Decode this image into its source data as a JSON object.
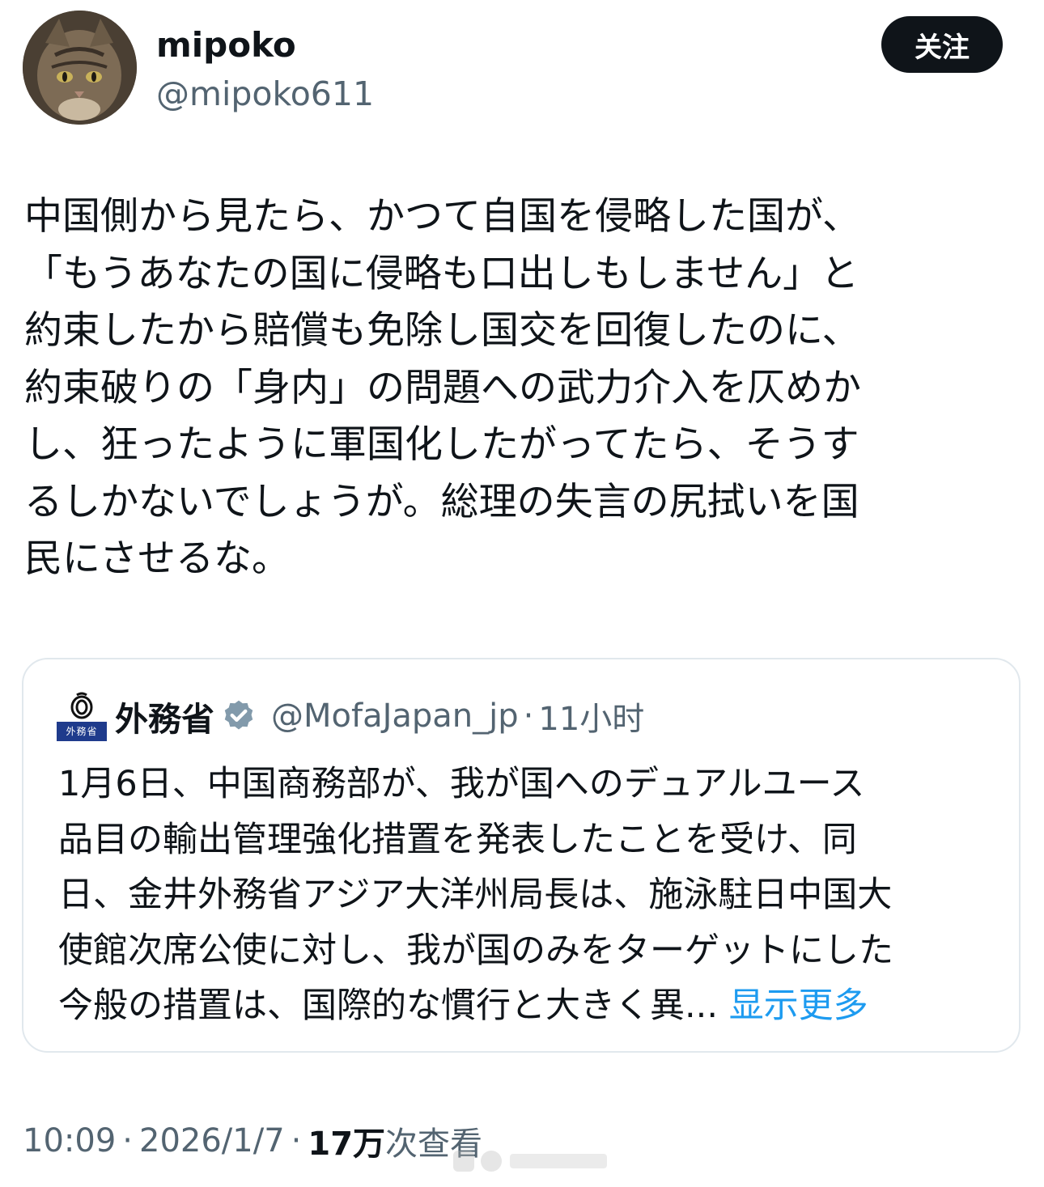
{
  "author": {
    "display_name": "mipoko",
    "handle": "@mipoko611",
    "avatar_icon": "cat-avatar"
  },
  "follow_button": {
    "label": "关注"
  },
  "tweet": {
    "lines": [
      "中国側から見たら、かつて自国を侵略した国が、",
      "「もうあなたの国に侵略も口出しもしません」と",
      "約束したから賠償も免除し国交を回復したのに、",
      "約束破りの「身内」の問題への武力介入を仄めか",
      "し、狂ったように軍国化したがってたら、そうす",
      "るしかないでしょうが。総理の失言の尻拭いを国",
      "民にさせるな。"
    ]
  },
  "quote": {
    "name": "外務省",
    "logo_text": "外務省",
    "handle": "@MofaJapan_jp",
    "dot": "·",
    "time": "11小时",
    "lines": [
      "1月6日、中国商務部が、我が国へのデュアルユース",
      "品目の輸出管理強化措置を発表したことを受け、同",
      "日、金井外務省アジア大洋州局長は、施泳駐日中国大",
      "使館次席公使に対し、我が国のみをターゲットにした"
    ],
    "last_line": "今般の措置は、国際的な慣行と大きく異...",
    "show_more": "显示更多",
    "verified_icon": "verified-badge-gray"
  },
  "meta": {
    "time": "10:09",
    "dot": "·",
    "date": "2026/1/7",
    "views_count": "17万",
    "views_label": "次查看"
  },
  "colors": {
    "text": "#0f1419",
    "secondary": "#536471",
    "link": "#1d9bf0",
    "button_bg": "#0f1419",
    "card_border": "#e1e8ed",
    "mofa_blue": "#1f3b8c"
  }
}
